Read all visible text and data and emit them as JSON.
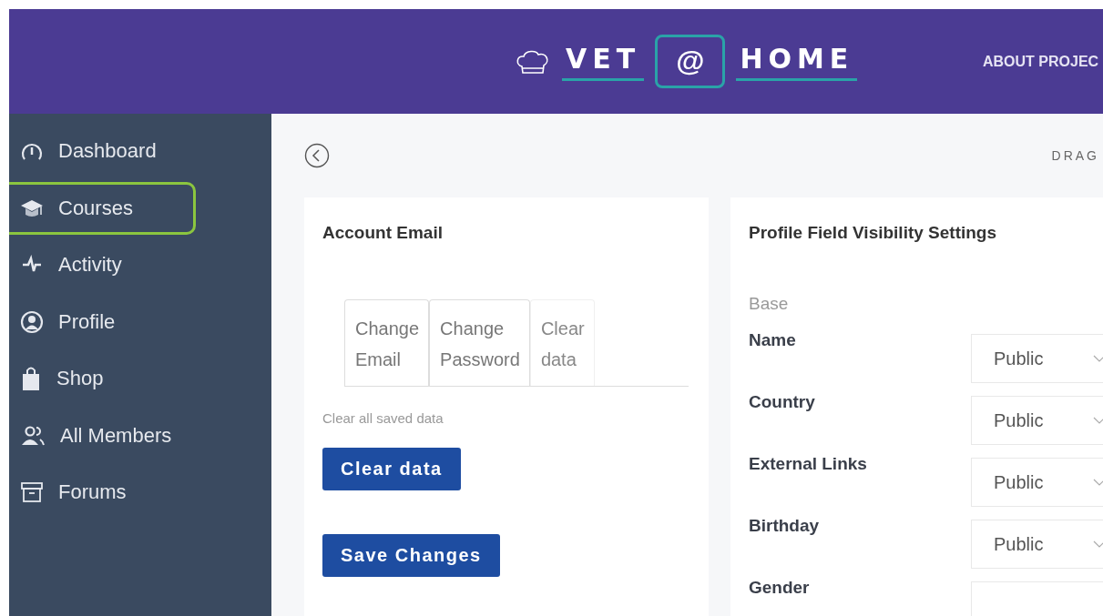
{
  "header": {
    "logo": {
      "left": "VET",
      "middle": "@",
      "right": "HOME"
    },
    "nav": [
      "ABOUT PROJEC"
    ]
  },
  "sidebar": {
    "items": [
      {
        "label": "Dashboard",
        "highlighted": false
      },
      {
        "label": "Courses",
        "highlighted": true
      },
      {
        "label": "Activity",
        "highlighted": false
      },
      {
        "label": "Profile",
        "highlighted": false
      },
      {
        "label": "Shop",
        "highlighted": false
      },
      {
        "label": "All Members",
        "highlighted": false
      },
      {
        "label": "Forums",
        "highlighted": false
      }
    ]
  },
  "topbar": {
    "right_text": "DRAG"
  },
  "account_card": {
    "title": "Account Email",
    "tabs": [
      {
        "label": "Change Email",
        "selected": false
      },
      {
        "label": "Change Password",
        "selected": false
      },
      {
        "label": "Clear data",
        "selected": true
      }
    ],
    "hint": "Clear all saved data",
    "buttons": [
      "Clear data",
      "Save Changes"
    ]
  },
  "visibility_card": {
    "title": "Profile Field Visibility Settings",
    "group": "Base",
    "fields": [
      {
        "label": "Name",
        "value": "Public"
      },
      {
        "label": "Country",
        "value": "Public"
      },
      {
        "label": "External Links",
        "value": "Public"
      },
      {
        "label": "Birthday",
        "value": "Public"
      },
      {
        "label": "Gender"
      }
    ]
  }
}
